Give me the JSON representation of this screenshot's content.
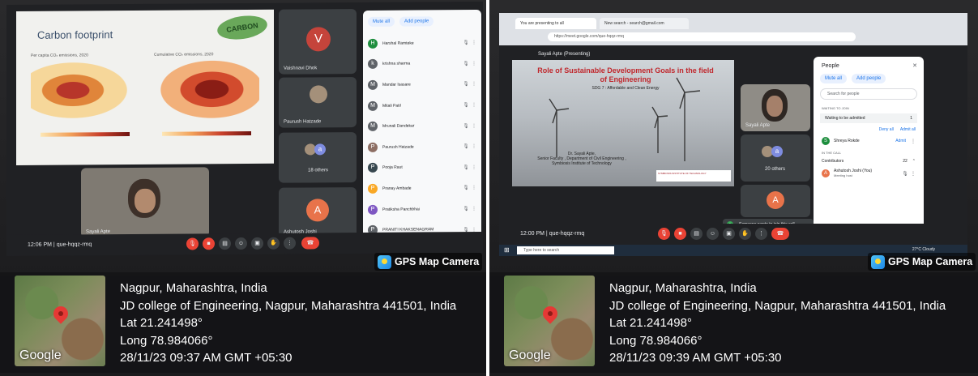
{
  "left_photo": {
    "slide": {
      "title": "Carbon footprint",
      "logo_text": "CARBON",
      "map_a_caption": "Per capita CO₂ emissions, 2020",
      "map_b_caption": "Cumulative CO₂ emissions, 2020"
    },
    "tiles": {
      "vaishnavi": {
        "initial": "V",
        "name": "Vaishnavi Dhok",
        "color": "#c5443b"
      },
      "paurush": {
        "name": "Paurush Hatzade"
      },
      "others": {
        "initial": "a",
        "label": "18 others",
        "color": "#7e8ce0"
      },
      "ashutosh": {
        "initial": "A",
        "name": "Ashutosh Joshi",
        "color": "#e8734a"
      },
      "self": {
        "name": "Sayali Apte"
      }
    },
    "people_panel": {
      "mute_all": "Mute all",
      "add_people": "Add people",
      "participants": [
        {
          "initial": "H",
          "name": "Harshal Ramteke",
          "color": "#1e8e3e"
        },
        {
          "initial": "k",
          "name": "krishna sharma",
          "color": "#5f6368"
        },
        {
          "initial": "M",
          "name": "Mandar Isasare",
          "color": "#5f6368"
        },
        {
          "initial": "M",
          "name": "Mitali Patil",
          "color": "#5f6368"
        },
        {
          "initial": "M",
          "name": "Mrunali Dandekar",
          "color": "#5f6368"
        },
        {
          "initial": "P",
          "name": "Paurush Hatzade",
          "color": "#8d6e63"
        },
        {
          "initial": "P",
          "name": "Pooja Raut",
          "color": "#37474f"
        },
        {
          "initial": "P",
          "name": "Pranay Ambade",
          "color": "#f9a825"
        },
        {
          "initial": "P",
          "name": "Pratiksha Panchbhai",
          "color": "#7e57c2"
        },
        {
          "initial": "P",
          "name": "PRANITI KHAKSENAGRAM",
          "color": "#5f6368"
        }
      ]
    },
    "meeting_bar": {
      "time": "12:06 PM",
      "separator": "|",
      "code": "que-hqqz-rmq"
    }
  },
  "right_photo": {
    "browser": {
      "tab_1": "You are presenting to all",
      "tab_2": "New search - search@gmail.com",
      "url": "https://meet.google.com/que-hqqz-rmq"
    },
    "presenting_label": "Sayali Apte (Presenting)",
    "slide": {
      "title": "Role of Sustainable Development Goals in the field of Engineering",
      "subtitle": "SDG 7 : Affordable and Clean Energy",
      "author_name": "Dr. Sayali Apte,",
      "author_role": "Senior Faculty , Department of Civil Engineering ,",
      "author_org": "Symbiosis Institute of Technology",
      "badge_text": "SYMBIOSIS INSTITUTE OF TECHNOLOGY"
    },
    "tiles": {
      "presenter": {
        "name": "Sayali Apte"
      },
      "others": {
        "initial": "a",
        "label": "20 others",
        "color": "#7e8ce0"
      },
      "ashutosh": {
        "initial": "A",
        "color": "#e8734a"
      }
    },
    "people_panel": {
      "title": "People",
      "close": "✕",
      "mute_all": "Mute all",
      "add_people": "Add people",
      "search_placeholder": "Search for people",
      "waiting_section": "WAITING TO JOIN",
      "waiting_label": "Waiting to be admitted",
      "waiting_count": "1",
      "deny_all": "Deny all",
      "admit_all": "Admit all",
      "waiting_person": {
        "initial": "S",
        "name": "Shreya Rokde",
        "action": "Admit",
        "color": "#1e8e3e"
      },
      "in_call_section": "IN THE CALL",
      "contributors_label": "Contributors",
      "contributors_count": "22",
      "first_contributor": {
        "initial": "A",
        "name": "Ashutosh Joshi (You)",
        "role": "Meeting host",
        "color": "#e8734a"
      }
    },
    "toast": "Someone wants to join this call",
    "meeting_bar": {
      "time": "12:00 PM",
      "separator": "|",
      "code": "que-hqqz-rmq"
    },
    "taskbar": {
      "search_placeholder": "Type here to search",
      "weather": "27°C Cloudy"
    }
  },
  "watermarks": [
    {
      "badge": "GPS Map Camera",
      "city": "Nagpur, Maharashtra, India",
      "address": "JD college of Engineering, Nagpur, Maharashtra 441501, India",
      "lat": "Lat 21.241498°",
      "long": "Long 78.984066°",
      "datetime": "28/11/23 09:37 AM GMT +05:30",
      "map_logo": "Google"
    },
    {
      "badge": "GPS Map Camera",
      "city": "Nagpur, Maharashtra, India",
      "address": "JD college of Engineering, Nagpur, Maharashtra 441501, India",
      "lat": "Lat 21.241498°",
      "long": "Long 78.984066°",
      "datetime": "28/11/23 09:39 AM GMT +05:30",
      "map_logo": "Google"
    }
  ],
  "icons": [
    "mic-off-icon",
    "camera-icon",
    "captions-icon",
    "emoji-icon",
    "present-icon",
    "hand-icon",
    "more-icon",
    "end-call-icon",
    "pin-icon",
    "gps-camera-icon"
  ],
  "colors": {
    "meet_background": "#202124",
    "tile": "#3c4043",
    "end_call": "#ea4335",
    "accent": "#1a73e8",
    "map_pin": "#e53935"
  }
}
